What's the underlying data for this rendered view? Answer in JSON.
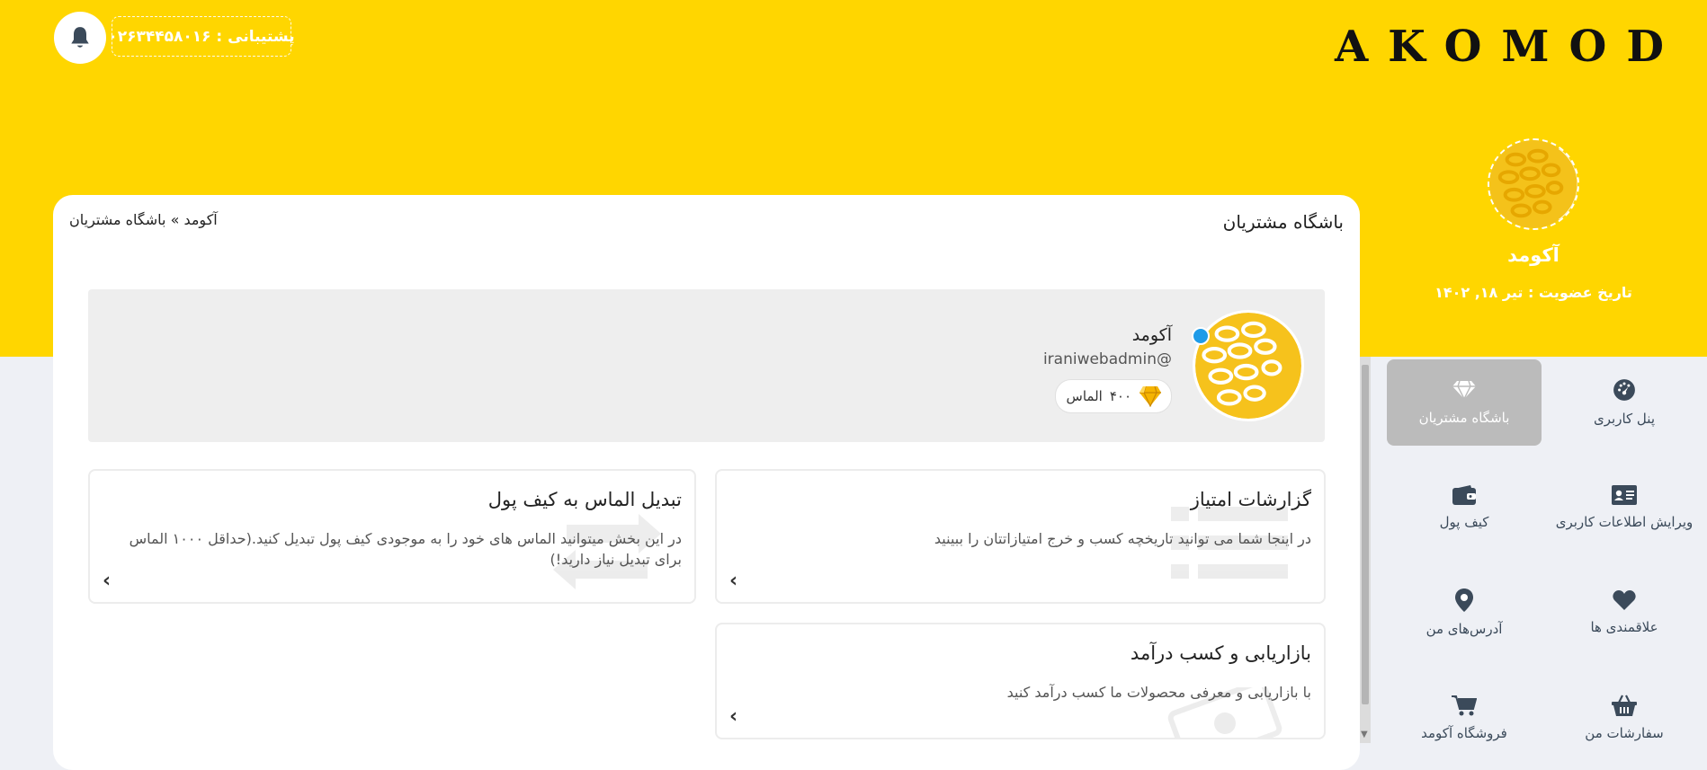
{
  "header": {
    "logo_text": "AKOMOD",
    "support_text": "پشتیبانی : ۰۲۶۳۴۴۵۸۰۱۶",
    "accent_color": "#ffd600"
  },
  "profile": {
    "name": "آکومد",
    "member_since": "تاریخ عضویت : تیر ۱۸, ۱۴۰۲"
  },
  "menu": [
    {
      "label": "پنل کاربری",
      "icon": "gauge-icon",
      "active": false
    },
    {
      "label": "باشگاه مشتریان",
      "icon": "diamond-icon",
      "active": true
    },
    {
      "label": "ویرایش اطلاعات کاربری",
      "icon": "id-card-icon",
      "active": false
    },
    {
      "label": "کیف پول",
      "icon": "wallet-icon",
      "active": false
    },
    {
      "label": "علاقمندی ها",
      "icon": "heart-icon",
      "active": false
    },
    {
      "label": "آدرس‌های من",
      "icon": "map-pin-icon",
      "active": false
    },
    {
      "label": "سفارشات من",
      "icon": "basket-icon",
      "active": false
    },
    {
      "label": "فروشگاه آکومد",
      "icon": "cart-icon",
      "active": false
    }
  ],
  "main": {
    "page_title": "باشگاه مشتریان",
    "breadcrumb": "آکومد » باشگاه مشتریان",
    "user": {
      "name": "آکومد",
      "handle": "iraniwebadmin@",
      "diamond_count": "۴۰۰",
      "diamond_unit": "الماس"
    },
    "features": [
      {
        "title": "گزارشات امتیاز",
        "desc": "در اینجا شما می توانید تاریخچه کسب و خرج امتیازاتتان را ببینید"
      },
      {
        "title": "تبدیل الماس به کیف پول",
        "desc": "در این بخش میتوانید الماس های خود را به موجودی کیف پول تبدیل کنید.(حداقل ۱۰۰۰ الماس برای تبدیل نیاز دارید!)"
      },
      {
        "title": "بازاریابی و کسب درآمد",
        "desc": "با بازاریابی و معرفی محصولات ما کسب درآمد کنید"
      }
    ]
  }
}
